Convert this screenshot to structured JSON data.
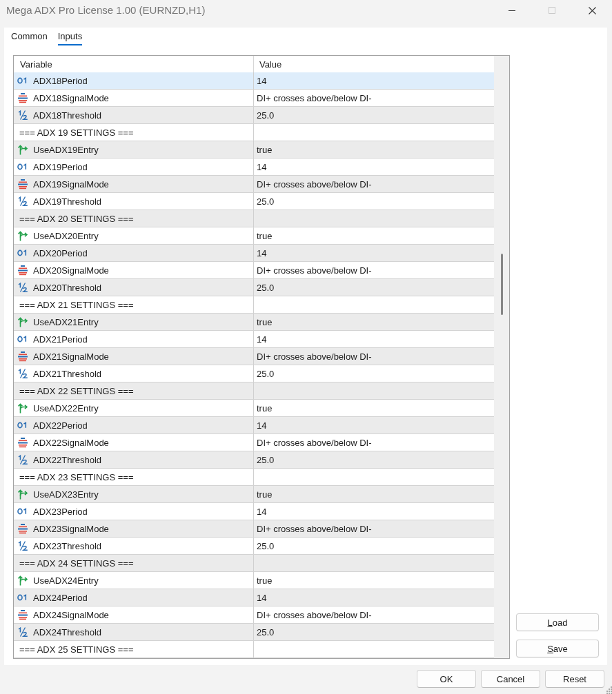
{
  "window": {
    "title": "Mega ADX Pro License 1.00 (EURNZD,H1)",
    "controls": [
      {
        "kind": "minimize",
        "disabled": false
      },
      {
        "kind": "maximize",
        "disabled": true
      },
      {
        "kind": "close",
        "disabled": false
      }
    ]
  },
  "tabs": [
    {
      "label": "Common",
      "selected": false
    },
    {
      "label": "Inputs",
      "selected": true
    }
  ],
  "table": {
    "columns": [
      "Variable",
      "Value"
    ],
    "rows": [
      {
        "kind": "int",
        "variable": "ADX18Period",
        "value": "14",
        "selected": true
      },
      {
        "kind": "enum",
        "variable": "ADX18SignalMode",
        "value": "DI+ crosses above/below DI-",
        "selected": false
      },
      {
        "kind": "double",
        "variable": "ADX18Threshold",
        "value": "25.0",
        "selected": false
      },
      {
        "kind": "section",
        "variable": "=== ADX 19 SETTINGS ===",
        "selected": false
      },
      {
        "kind": "bool",
        "variable": "UseADX19Entry",
        "value": "true",
        "selected": false
      },
      {
        "kind": "int",
        "variable": "ADX19Period",
        "value": "14",
        "selected": false
      },
      {
        "kind": "enum",
        "variable": "ADX19SignalMode",
        "value": "DI+ crosses above/below DI-",
        "selected": false
      },
      {
        "kind": "double",
        "variable": "ADX19Threshold",
        "value": "25.0",
        "selected": false
      },
      {
        "kind": "section",
        "variable": "=== ADX 20 SETTINGS ===",
        "selected": false
      },
      {
        "kind": "bool",
        "variable": "UseADX20Entry",
        "value": "true",
        "selected": false
      },
      {
        "kind": "int",
        "variable": "ADX20Period",
        "value": "14",
        "selected": false
      },
      {
        "kind": "enum",
        "variable": "ADX20SignalMode",
        "value": "DI+ crosses above/below DI-",
        "selected": false
      },
      {
        "kind": "double",
        "variable": "ADX20Threshold",
        "value": "25.0",
        "selected": false
      },
      {
        "kind": "section",
        "variable": "=== ADX 21 SETTINGS ===",
        "selected": false
      },
      {
        "kind": "bool",
        "variable": "UseADX21Entry",
        "value": "true",
        "selected": false
      },
      {
        "kind": "int",
        "variable": "ADX21Period",
        "value": "14",
        "selected": false
      },
      {
        "kind": "enum",
        "variable": "ADX21SignalMode",
        "value": "DI+ crosses above/below DI-",
        "selected": false
      },
      {
        "kind": "double",
        "variable": "ADX21Threshold",
        "value": "25.0",
        "selected": false
      },
      {
        "kind": "section",
        "variable": "=== ADX 22 SETTINGS ===",
        "selected": false
      },
      {
        "kind": "bool",
        "variable": "UseADX22Entry",
        "value": "true",
        "selected": false
      },
      {
        "kind": "int",
        "variable": "ADX22Period",
        "value": "14",
        "selected": false
      },
      {
        "kind": "enum",
        "variable": "ADX22SignalMode",
        "value": "DI+ crosses above/below DI-",
        "selected": false
      },
      {
        "kind": "double",
        "variable": "ADX22Threshold",
        "value": "25.0",
        "selected": false
      },
      {
        "kind": "section",
        "variable": "=== ADX 23 SETTINGS ===",
        "selected": false
      },
      {
        "kind": "bool",
        "variable": "UseADX23Entry",
        "value": "true",
        "selected": false
      },
      {
        "kind": "int",
        "variable": "ADX23Period",
        "value": "14",
        "selected": false
      },
      {
        "kind": "enum",
        "variable": "ADX23SignalMode",
        "value": "DI+ crosses above/below DI-",
        "selected": false
      },
      {
        "kind": "double",
        "variable": "ADX23Threshold",
        "value": "25.0",
        "selected": false
      },
      {
        "kind": "section",
        "variable": "=== ADX 24 SETTINGS ===",
        "selected": false
      },
      {
        "kind": "bool",
        "variable": "UseADX24Entry",
        "value": "true",
        "selected": false
      },
      {
        "kind": "int",
        "variable": "ADX24Period",
        "value": "14",
        "selected": false
      },
      {
        "kind": "enum",
        "variable": "ADX24SignalMode",
        "value": "DI+ crosses above/below DI-",
        "selected": false
      },
      {
        "kind": "double",
        "variable": "ADX24Threshold",
        "value": "25.0",
        "selected": false
      },
      {
        "kind": "section",
        "variable": "=== ADX 25 SETTINGS ===",
        "selected": false
      }
    ]
  },
  "side_buttons": [
    {
      "label": "Load",
      "access_key_shown": true
    },
    {
      "label": "Save",
      "access_key_shown": true
    }
  ],
  "buttons": [
    {
      "label": "OK"
    },
    {
      "label": "Cancel"
    },
    {
      "label": "Reset"
    }
  ]
}
